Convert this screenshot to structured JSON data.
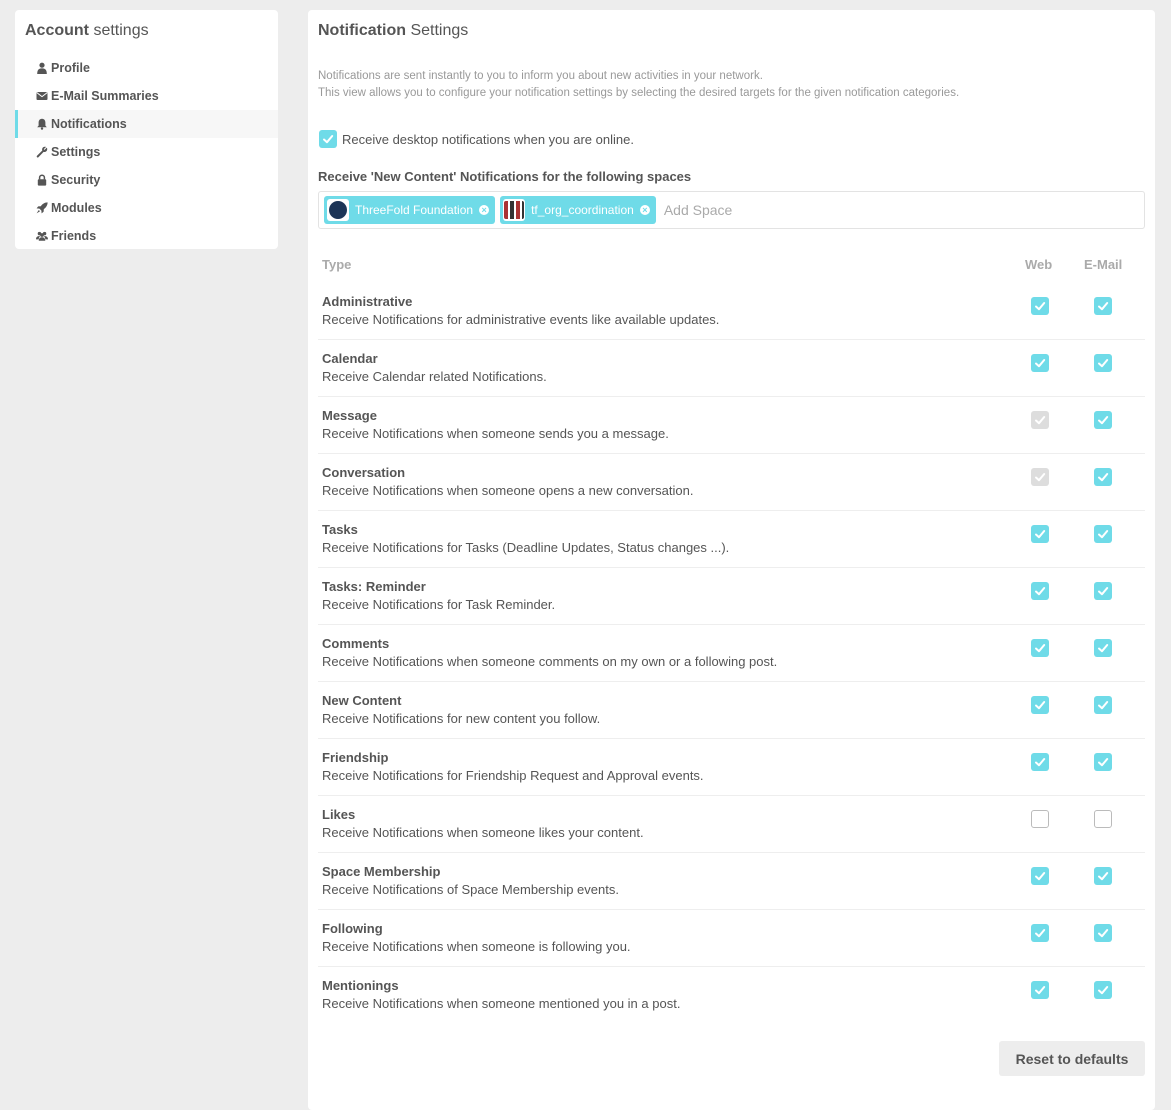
{
  "sidebar": {
    "title_bold": "Account",
    "title_rest": " settings",
    "items": [
      {
        "label": "Profile",
        "icon": "user-icon"
      },
      {
        "label": "E-Mail Summaries",
        "icon": "envelope-icon"
      },
      {
        "label": "Notifications",
        "icon": "bell-icon",
        "active": true
      },
      {
        "label": "Settings",
        "icon": "wrench-icon"
      },
      {
        "label": "Security",
        "icon": "lock-icon"
      },
      {
        "label": "Modules",
        "icon": "rocket-icon"
      },
      {
        "label": "Friends",
        "icon": "users-icon"
      }
    ]
  },
  "panel": {
    "title_bold": "Notification",
    "title_rest": " Settings",
    "help_line1": "Notifications are sent instantly to you to inform you about new activities in your network.",
    "help_line2": "This view allows you to configure your notification settings by selecting the desired targets for the given notification categories.",
    "desktop_label": "Receive desktop notifications when you are online.",
    "desktop_checked": true,
    "spaces_label": "Receive 'New Content' Notifications for the following spaces",
    "spaces": [
      {
        "name": "ThreeFold Foundation"
      },
      {
        "name": "tf_org_coordination"
      }
    ],
    "add_space_placeholder": "Add Space",
    "col_type": "Type",
    "col_web": "Web",
    "col_mail": "E-Mail",
    "reset_label": "Reset to defaults"
  },
  "categories": [
    {
      "title": "Administrative",
      "desc": "Receive Notifications for administrative events like available updates.",
      "web": "on",
      "mail": "on"
    },
    {
      "title": "Calendar",
      "desc": "Receive Calendar related Notifications.",
      "web": "on",
      "mail": "on"
    },
    {
      "title": "Message",
      "desc": "Receive Notifications when someone sends you a message.",
      "web": "dis",
      "mail": "on"
    },
    {
      "title": "Conversation",
      "desc": "Receive Notifications when someone opens a new conversation.",
      "web": "dis",
      "mail": "on"
    },
    {
      "title": "Tasks",
      "desc": "Receive Notifications for Tasks (Deadline Updates, Status changes ...).",
      "web": "on",
      "mail": "on"
    },
    {
      "title": "Tasks: Reminder",
      "desc": "Receive Notifications for Task Reminder.",
      "web": "on",
      "mail": "on"
    },
    {
      "title": "Comments",
      "desc": "Receive Notifications when someone comments on my own or a following post.",
      "web": "on",
      "mail": "on"
    },
    {
      "title": "New Content",
      "desc": "Receive Notifications for new content you follow.",
      "web": "on",
      "mail": "on"
    },
    {
      "title": "Friendship",
      "desc": "Receive Notifications for Friendship Request and Approval events.",
      "web": "on",
      "mail": "on"
    },
    {
      "title": "Likes",
      "desc": "Receive Notifications when someone likes your content.",
      "web": "off",
      "mail": "off"
    },
    {
      "title": "Space Membership",
      "desc": "Receive Notifications of Space Membership events.",
      "web": "on",
      "mail": "on"
    },
    {
      "title": "Following",
      "desc": "Receive Notifications when someone is following you.",
      "web": "on",
      "mail": "on"
    },
    {
      "title": "Mentionings",
      "desc": "Receive Notifications when someone mentioned you in a post.",
      "web": "on",
      "mail": "on"
    }
  ],
  "colors": {
    "accent": "#6fdbe8",
    "disabled": "#dddddd"
  }
}
